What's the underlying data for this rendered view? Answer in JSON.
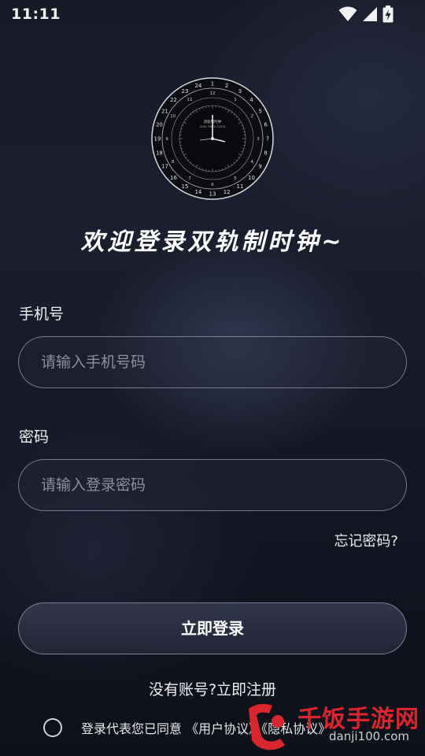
{
  "status_bar": {
    "time": "11:11",
    "icons": [
      "wifi-icon",
      "signal-icon",
      "battery-charging-icon"
    ]
  },
  "logo": {
    "icon": "dual-track-clock-logo",
    "label_top": "双轨制时钟",
    "label_bottom": "DUAL TRACK CLOCK"
  },
  "welcome_title": "欢迎登录双轨制时钟~",
  "phone": {
    "label": "手机号",
    "placeholder": "请输入手机号码",
    "value": ""
  },
  "password": {
    "label": "密码",
    "placeholder": "请输入登录密码",
    "value": ""
  },
  "forgot_password": "忘记密码?",
  "login_button": "立即登录",
  "register": {
    "prompt": "没有账号?",
    "link": "立即注册"
  },
  "agreement": {
    "checked": false,
    "text": "登录代表您已同意",
    "user_agreement": "《用户协议》",
    "privacy_policy": "《隐私协议》"
  },
  "watermark": {
    "text": "千饭手游网",
    "url": "danji100.com"
  },
  "colors": {
    "background": "#161a28",
    "accent_red": "#d9262e",
    "input_border": "#bec3d2"
  }
}
